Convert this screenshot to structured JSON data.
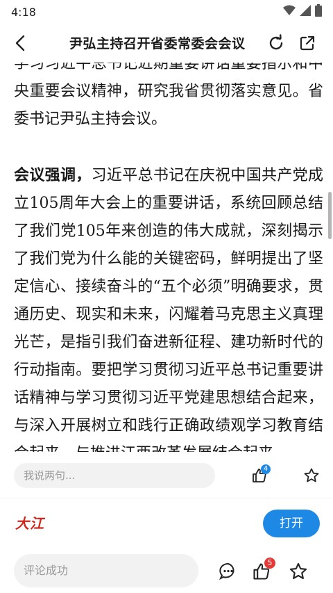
{
  "status_bar": {
    "time": "4:18",
    "icons": [
      "wifi-icon",
      "signal-icon",
      "battery-icon"
    ]
  },
  "nav": {
    "back_icon": "back-arrow-icon",
    "title": "尹弘主持召开省委常委会会议",
    "refresh_icon": "refresh-icon",
    "share_icon": "share-external-icon"
  },
  "article": {
    "paragraph_1": "学习习近平总书记近期重要讲话重要指示和中央重要会议精神，研究我省贯彻落实意见。省委书记尹弘主持会议。",
    "paragraph_2_lead": "会议强调，",
    "paragraph_2_body": "习近平总书记在庆祝中国共产党成立105周年大会上的重要讲话，系统回顾总结了我们党105年来创造的伟大成就，深刻揭示了我们党为什么能的关键密码，鲜明提出了坚定信心、接续奋斗的“五个必须”明确要求，贯通历史、现实和未来，闪耀着马克思主义真理光芒，是指引我们奋进新征程、建功新时代的行动指南。要把学习贯彻习近平总书记重要讲话精神与学习贯彻习近平党建思想结合起来，与深入开展树立和践行正确政绩观学习教育结合起来，与推进江西改革发展结合起来"
  },
  "comment_bar_top": {
    "placeholder": "我说两句...",
    "like_count": "4",
    "like_icon": "thumbs-up-icon",
    "star_icon": "star-icon"
  },
  "app_banner": {
    "logo_text": "大江",
    "open_label": "打开"
  },
  "comment_bar_bottom": {
    "placeholder": "评论成功",
    "comment_icon": "comment-bubble-icon",
    "like_icon": "thumbs-up-icon",
    "like_count": "5",
    "star_icon": "star-icon"
  },
  "colors": {
    "accent_blue": "#1e88e5",
    "badge_red": "#e53935",
    "logo_red": "#d3261b",
    "input_bg": "#f2f2f2"
  }
}
